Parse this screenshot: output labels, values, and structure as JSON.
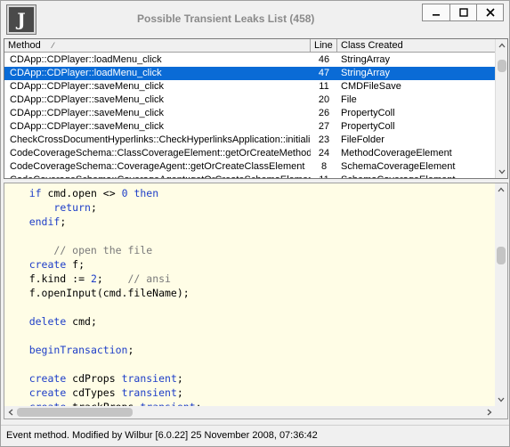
{
  "window": {
    "title": "Possible Transient Leaks List (458)",
    "icon_letter": "J"
  },
  "table": {
    "columns": [
      "Method",
      "Line",
      "Class Created"
    ],
    "selected_index": 1,
    "rows": [
      {
        "method": "CDApp::CDPlayer::loadMenu_click",
        "line": "46",
        "class": "StringArray"
      },
      {
        "method": "CDApp::CDPlayer::loadMenu_click",
        "line": "47",
        "class": "StringArray"
      },
      {
        "method": "CDApp::CDPlayer::saveMenu_click",
        "line": "11",
        "class": "CMDFileSave"
      },
      {
        "method": "CDApp::CDPlayer::saveMenu_click",
        "line": "20",
        "class": "File"
      },
      {
        "method": "CDApp::CDPlayer::saveMenu_click",
        "line": "26",
        "class": "PropertyColl"
      },
      {
        "method": "CDApp::CDPlayer::saveMenu_click",
        "line": "27",
        "class": "PropertyColl"
      },
      {
        "method": "CheckCrossDocumentHyperlinks::CheckHyperlinksApplication::initialize",
        "line": "23",
        "class": "FileFolder"
      },
      {
        "method": "CodeCoverageSchema::ClassCoverageElement::getOrCreateMethodElement",
        "line": "24",
        "class": "MethodCoverageElement"
      },
      {
        "method": "CodeCoverageSchema::CoverageAgent::getOrCreateClassElement",
        "line": "8",
        "class": "SchemaCoverageElement"
      },
      {
        "method": "CodeCoverageSchema::CoverageAgent::getOrCreateSchemaElement",
        "line": "11",
        "class": "SchemaCoverageElement"
      }
    ]
  },
  "code": {
    "lines": [
      [
        {
          "t": "    "
        },
        {
          "k": "if"
        },
        {
          "t": " cmd.open <> "
        },
        {
          "n": "0"
        },
        {
          "t": " "
        },
        {
          "k": "then"
        }
      ],
      [
        {
          "t": "        "
        },
        {
          "k": "return"
        },
        {
          "t": ";"
        }
      ],
      [
        {
          "t": "    "
        },
        {
          "k": "endif"
        },
        {
          "t": ";"
        }
      ],
      [],
      [
        {
          "t": "        "
        },
        {
          "c": "// open the file"
        }
      ],
      [
        {
          "t": "    "
        },
        {
          "k": "create"
        },
        {
          "t": " f;"
        }
      ],
      [
        {
          "t": "    f.kind := "
        },
        {
          "n": "2"
        },
        {
          "t": ";    "
        },
        {
          "c": "// ansi"
        }
      ],
      [
        {
          "t": "    f.openInput(cmd.fileName);"
        }
      ],
      [],
      [
        {
          "t": "    "
        },
        {
          "k": "delete"
        },
        {
          "t": " cmd;"
        }
      ],
      [],
      [
        {
          "t": "    "
        },
        {
          "k": "beginTransaction"
        },
        {
          "t": ";"
        }
      ],
      [],
      [
        {
          "t": "    "
        },
        {
          "k": "create"
        },
        {
          "t": " cdProps "
        },
        {
          "k": "transient"
        },
        {
          "t": ";"
        }
      ],
      [
        {
          "t": "    "
        },
        {
          "k": "create"
        },
        {
          "t": " cdTypes "
        },
        {
          "k": "transient"
        },
        {
          "t": ";"
        }
      ],
      [
        {
          "t": "    "
        },
        {
          "k": "create"
        },
        {
          "t": " trackProps "
        },
        {
          "k": "transient"
        },
        {
          "t": ";"
        }
      ]
    ]
  },
  "status": {
    "text": "Event method. Modified by Wilbur [6.0.22] 25 November 2008, 07:36:42"
  },
  "scroll": {
    "table_v_fraction": 0.08,
    "code_v_fraction": 0.28,
    "code_h_fraction": 0.0
  },
  "colors": {
    "selection": "#0a6bd6",
    "keyword": "#1e3ec8",
    "comment": "#7a7a7a",
    "code_background": "#fffde6"
  }
}
